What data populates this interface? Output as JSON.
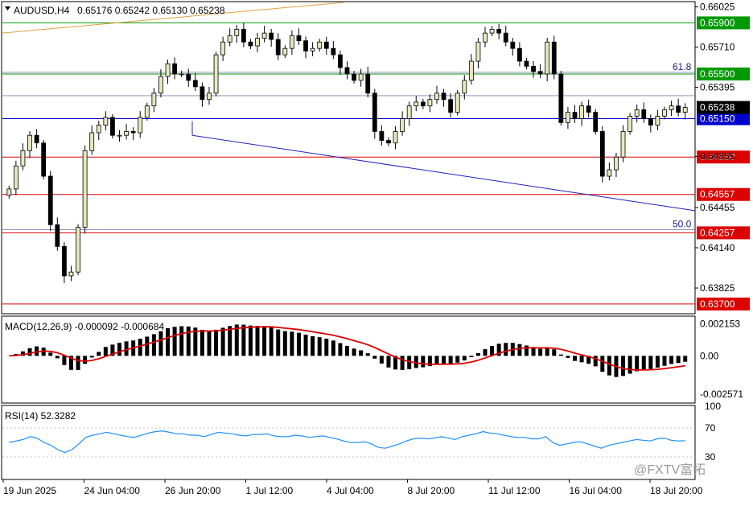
{
  "header": {
    "symbol": "AUDUSD,H4",
    "ohlc": "0.65176 0.65242 0.65130 0.65238"
  },
  "chart_data": {
    "type": "candlestick",
    "symbol": "AUDUSD",
    "timeframe": "H4",
    "price_axis_ticks": [
      "0.66025",
      "0.65710",
      "0.65395",
      "0.64855",
      "0.64455",
      "0.64140",
      "0.63825"
    ],
    "price_axis_tick_values": [
      0.66025,
      0.6571,
      0.65395,
      0.64855,
      0.64455,
      0.6414,
      0.63825
    ],
    "ylim": [
      0.6363,
      0.6606
    ],
    "time_axis_ticks": [
      "19 Jun 2025",
      "24 Jun 04:00",
      "26 Jun 20:00",
      "1 Jul 12:00",
      "4 Jul 04:00",
      "8 Jul 20:00",
      "11 Jul 12:00",
      "16 Jul 04:00",
      "18 Jul 20:00"
    ],
    "current_price": "0.65238",
    "levels": [
      {
        "label": "0.65900",
        "value": 0.659,
        "color": "#009900"
      },
      {
        "label": "0.65500",
        "value": 0.655,
        "color": "#009900"
      },
      {
        "label": "0.65150",
        "value": 0.6515,
        "color": "#0000cc"
      },
      {
        "label": "0.64850",
        "value": 0.6485,
        "color": "#dd0000"
      },
      {
        "label": "0.64557",
        "value": 0.64557,
        "color": "#dd0000"
      },
      {
        "label": "0.64257",
        "value": 0.64257,
        "color": "#dd0000"
      },
      {
        "label": "0.63700",
        "value": 0.637,
        "color": "#dd0000"
      }
    ],
    "fib_labels": [
      {
        "label": "61.8",
        "value": 0.655
      },
      {
        "label": "50.0",
        "value": 0.6427
      }
    ],
    "closes": [
      0.646,
      0.6478,
      0.649,
      0.6502,
      0.6496,
      0.647,
      0.6432,
      0.6415,
      0.6392,
      0.6395,
      0.643,
      0.649,
      0.6504,
      0.651,
      0.6516,
      0.6502,
      0.6502,
      0.6505,
      0.6504,
      0.6516,
      0.6525,
      0.6535,
      0.6548,
      0.6558,
      0.655,
      0.655,
      0.6545,
      0.654,
      0.653,
      0.6535,
      0.6565,
      0.6575,
      0.658,
      0.6585,
      0.6575,
      0.6572,
      0.6578,
      0.6582,
      0.6577,
      0.6565,
      0.657,
      0.658,
      0.6576,
      0.6568,
      0.657,
      0.6575,
      0.657,
      0.6565,
      0.6555,
      0.655,
      0.6545,
      0.655,
      0.6535,
      0.6505,
      0.6498,
      0.6496,
      0.6505,
      0.6515,
      0.6525,
      0.6528,
      0.6525,
      0.653,
      0.6535,
      0.653,
      0.652,
      0.6535,
      0.6545,
      0.656,
      0.6575,
      0.6582,
      0.6585,
      0.6582,
      0.6575,
      0.657,
      0.656,
      0.6556,
      0.6552,
      0.655,
      0.6575,
      0.655,
      0.6512,
      0.652,
      0.6515,
      0.6525,
      0.652,
      0.6505,
      0.647,
      0.6475,
      0.6485,
      0.6505,
      0.6517,
      0.6522,
      0.6515,
      0.651,
      0.6517,
      0.6522,
      0.6525,
      0.652,
      0.65238
    ],
    "macd": {
      "label": "MACD(12,26,9) -0.000092 -0.000684",
      "ticks": [
        "0.002153",
        "0.00",
        "-0.002571"
      ],
      "tick_values": [
        0.002153,
        0.0,
        -0.002571
      ],
      "ylim": [
        -0.0031,
        0.0026
      ]
    },
    "rsi": {
      "label": "RSI(14) 52.3282",
      "ticks": [
        "100",
        "70",
        "30"
      ],
      "tick_values": [
        100,
        70,
        30
      ],
      "ylim": [
        0,
        100
      ],
      "values": [
        50,
        52,
        54,
        58,
        56,
        50,
        46,
        40,
        36,
        40,
        48,
        57,
        60,
        62,
        64,
        62,
        60,
        58,
        57,
        60,
        63,
        65,
        66,
        64,
        62,
        62,
        60,
        60,
        58,
        61,
        64,
        63,
        62,
        60,
        59,
        61,
        61,
        62,
        59,
        58,
        58,
        60,
        59,
        57,
        58,
        59,
        57,
        55,
        52,
        50,
        50,
        51,
        48,
        43,
        42,
        45,
        48,
        52,
        55,
        56,
        55,
        56,
        58,
        56,
        54,
        58,
        60,
        62,
        65,
        63,
        62,
        60,
        58,
        57,
        57,
        55,
        55,
        58,
        50,
        46,
        48,
        50,
        51,
        48,
        45,
        42,
        46,
        48,
        50,
        52,
        54,
        53,
        52,
        55,
        56,
        53,
        52,
        52.3
      ]
    }
  },
  "watermark": "@FXTV富拓"
}
